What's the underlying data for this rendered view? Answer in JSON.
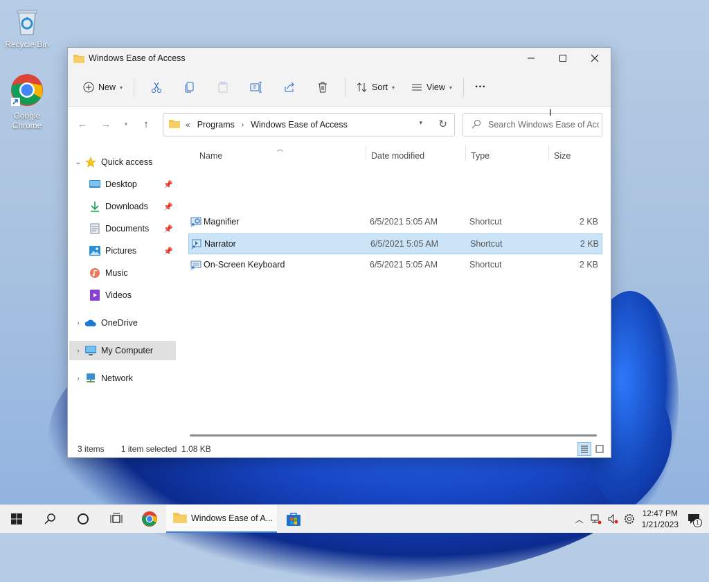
{
  "desktop": {
    "icons": [
      {
        "label": "Recycle Bin",
        "icon": "recycle-bin-icon"
      },
      {
        "label": "Google Chrome",
        "icon": "chrome-icon"
      }
    ]
  },
  "window": {
    "title": "Windows Ease of Access",
    "controls": {
      "minimize": "–",
      "maximize": "☐",
      "close": "✕"
    }
  },
  "toolbar": {
    "new_label": "New",
    "sort_label": "Sort",
    "view_label": "View",
    "more_label": "···"
  },
  "address": {
    "overflow": "«",
    "crumbs": [
      "Programs",
      "Windows Ease of Access"
    ],
    "separator": "›"
  },
  "search": {
    "placeholder": "Search Windows Ease of Acc..."
  },
  "sidebar": {
    "items": [
      {
        "label": "Quick access",
        "icon": "star-icon"
      },
      {
        "label": "Desktop",
        "icon": "desktop-icon",
        "pinned": true
      },
      {
        "label": "Downloads",
        "icon": "download-icon",
        "pinned": true
      },
      {
        "label": "Documents",
        "icon": "documents-icon",
        "pinned": true
      },
      {
        "label": "Pictures",
        "icon": "pictures-icon",
        "pinned": true
      },
      {
        "label": "Music",
        "icon": "music-icon"
      },
      {
        "label": "Videos",
        "icon": "videos-icon"
      },
      {
        "label": "OneDrive",
        "icon": "cloud-icon"
      },
      {
        "label": "My Computer",
        "icon": "computer-icon"
      },
      {
        "label": "Network",
        "icon": "network-icon"
      }
    ]
  },
  "files": {
    "columns": [
      "Name",
      "Date modified",
      "Type",
      "Size"
    ],
    "rows": [
      {
        "name": "Magnifier",
        "date": "6/5/2021 5:05 AM",
        "type": "Shortcut",
        "size": "2 KB"
      },
      {
        "name": "Narrator",
        "date": "6/5/2021 5:05 AM",
        "type": "Shortcut",
        "size": "2 KB"
      },
      {
        "name": "On-Screen Keyboard",
        "date": "6/5/2021 5:05 AM",
        "type": "Shortcut",
        "size": "2 KB"
      }
    ]
  },
  "status": {
    "items": "3 items",
    "selected": "1 item selected  1.08 KB"
  },
  "taskbar": {
    "app_label": "Windows Ease of A...",
    "time": "12:47 PM",
    "date": "1/21/2023",
    "notification_count": "1"
  },
  "colors": {
    "accent": "#3b7ddd",
    "selection": "#cce4f7",
    "folder": "#f2c14e"
  }
}
